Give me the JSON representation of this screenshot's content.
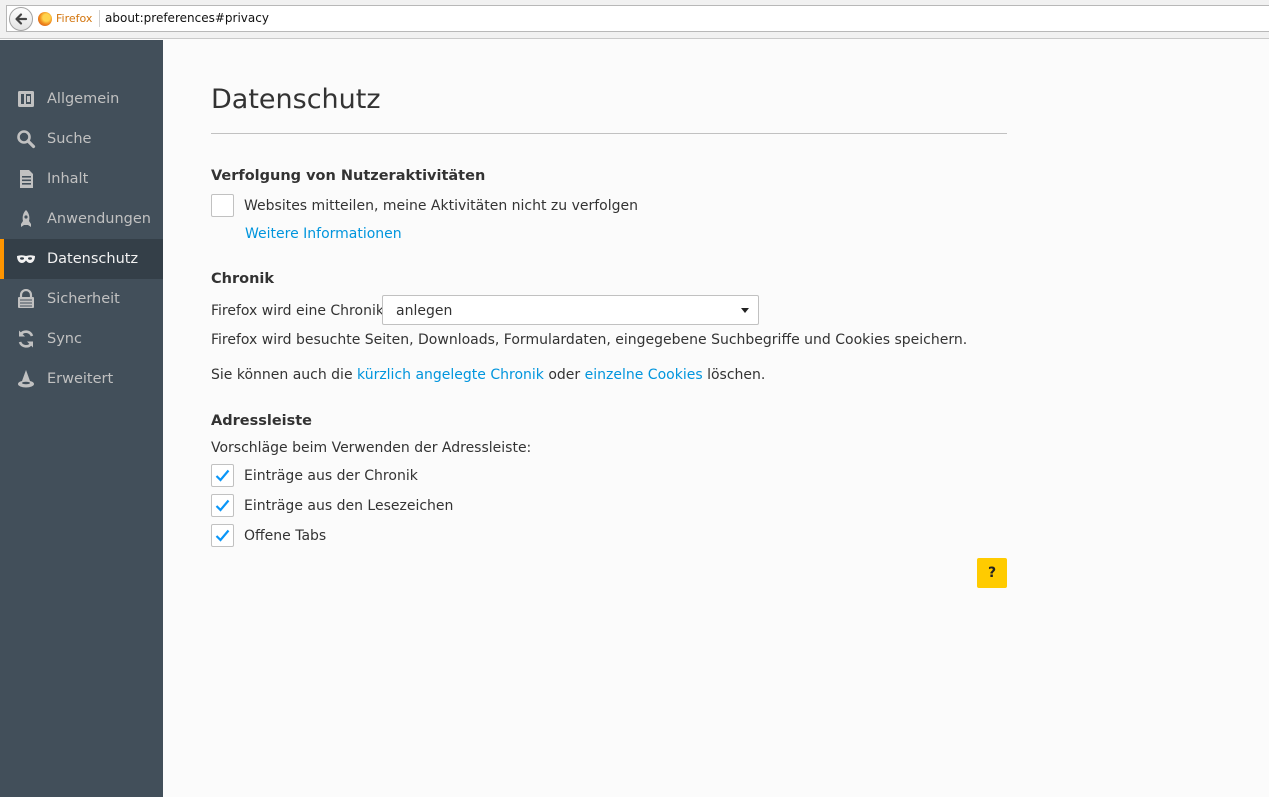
{
  "browser": {
    "identity_label": "Firefox",
    "url": "about:preferences#privacy"
  },
  "sidebar": {
    "items": [
      {
        "label": "Allgemein",
        "icon": "general-icon",
        "active": false
      },
      {
        "label": "Suche",
        "icon": "search-icon",
        "active": false
      },
      {
        "label": "Inhalt",
        "icon": "content-icon",
        "active": false
      },
      {
        "label": "Anwendungen",
        "icon": "applications-icon",
        "active": false
      },
      {
        "label": "Datenschutz",
        "icon": "privacy-mask-icon",
        "active": true
      },
      {
        "label": "Sicherheit",
        "icon": "security-icon",
        "active": false
      },
      {
        "label": "Sync",
        "icon": "sync-icon",
        "active": false
      },
      {
        "label": "Erweitert",
        "icon": "advanced-icon",
        "active": false
      }
    ]
  },
  "main": {
    "title": "Datenschutz",
    "tracking": {
      "heading": "Verfolgung von Nutzeraktivitäten",
      "dnt_label": "Websites mitteilen, meine Aktivitäten nicht zu verfolgen",
      "dnt_checked": false,
      "more_info": "Weitere Informationen"
    },
    "history": {
      "heading": "Chronik",
      "select_label": "Firefox wird eine Chronik:",
      "select_value": "anlegen",
      "description": "Firefox wird besuchte Seiten, Downloads, Formulardaten, eingegebene Suchbegriffe und Cookies speichern.",
      "clear_prefix": "Sie können auch die",
      "clear_link_history": "kürzlich angelegte Chronik",
      "clear_middle": "oder",
      "clear_link_cookies": "einzelne Cookies",
      "clear_suffix": "löschen."
    },
    "locationbar": {
      "heading": "Adressleiste",
      "intro": "Vorschläge beim Verwenden der Adressleiste:",
      "options": [
        {
          "label": "Einträge aus der Chronik",
          "checked": true
        },
        {
          "label": "Einträge aus den Lesezeichen",
          "checked": true
        },
        {
          "label": "Offene Tabs",
          "checked": true
        }
      ]
    },
    "help_label": "?"
  },
  "colors": {
    "sidebar_bg": "#424f5a",
    "sidebar_active_bg": "#343f48",
    "active_indicator": "#ff9500",
    "link": "#0095dd",
    "checkmark": "#0996f8",
    "help_button": "#ffcb00"
  }
}
